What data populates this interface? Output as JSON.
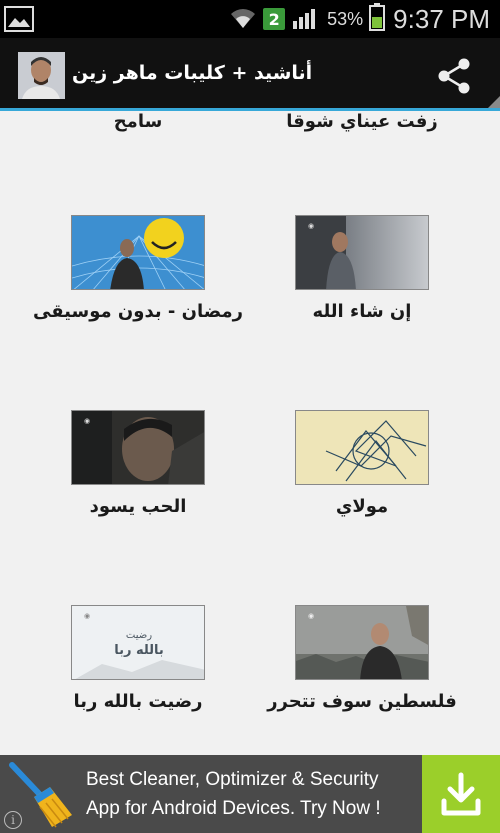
{
  "status_bar": {
    "notification_count": "2",
    "battery_percent": "53%",
    "time": "9:37 PM"
  },
  "action_bar": {
    "title": "أناشيد + كليبات ماهر زين",
    "icons": [
      "app-avatar",
      "share-icon",
      "overflow-indicator"
    ]
  },
  "partial_row": {
    "right_label": "زفت عيناي شوقا",
    "left_label": "سامح"
  },
  "videos": [
    {
      "title": "إن شاء الله"
    },
    {
      "title": "رمضان - بدون موسيقى"
    },
    {
      "title": "مولاي"
    },
    {
      "title": "الحب يسود"
    },
    {
      "title": "فلسطين سوف تتحرر"
    },
    {
      "title": "رضيت بالله ربا"
    }
  ],
  "thumbnails": {
    "radheet_line1": "رضيت",
    "radheet_line2": "بالله ربا"
  },
  "ad": {
    "text": "Best Cleaner, Optimizer & Security App for Android Devices. Try Now !",
    "info_symbol": "i",
    "accent_color": "#9bcf2a"
  },
  "colors": {
    "action_bar_accent": "#37a8d8",
    "background": "#f1f1f1"
  }
}
